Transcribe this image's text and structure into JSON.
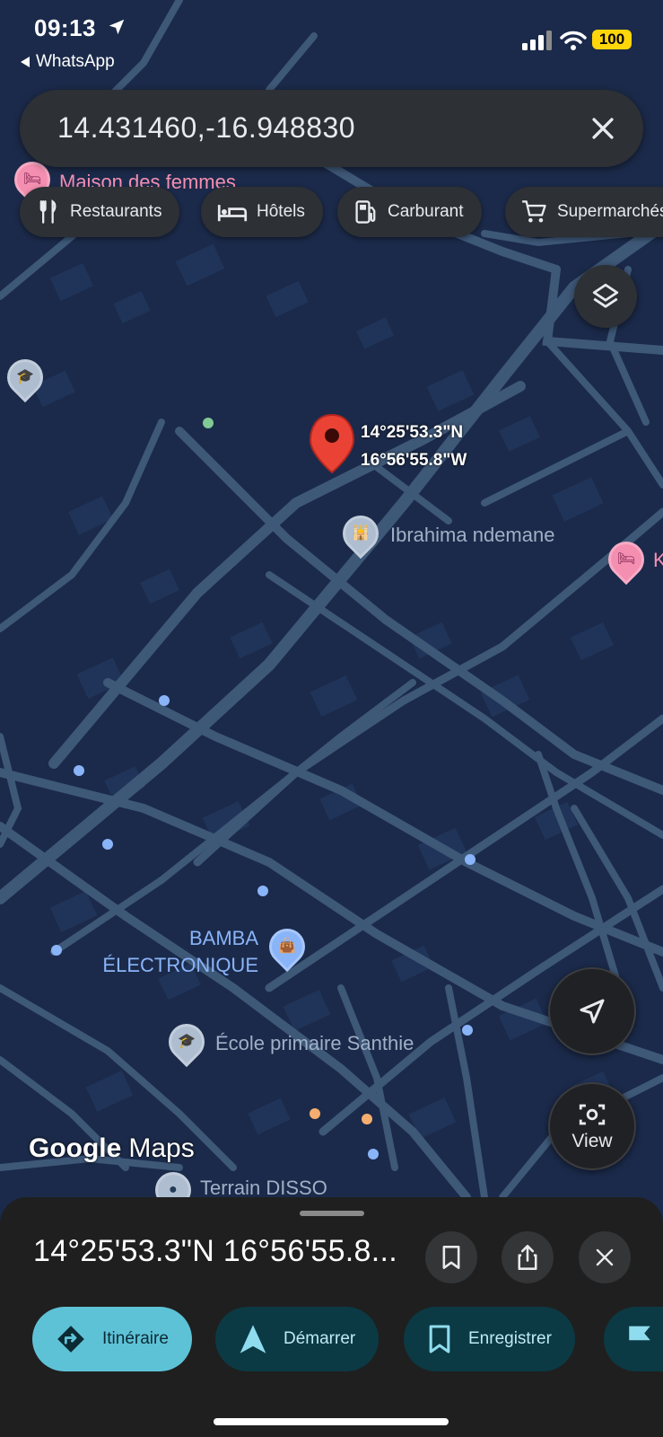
{
  "status_bar": {
    "time": "09:13",
    "back_app": "WhatsApp",
    "battery": "100"
  },
  "search": {
    "value": "14.431460,-16.948830"
  },
  "chips": [
    {
      "label": "Restaurants",
      "icon": "fork-knife-icon"
    },
    {
      "label": "Hôtels",
      "icon": "bed-icon"
    },
    {
      "label": "Carburant",
      "icon": "fuel-icon"
    },
    {
      "label": "Supermarchés",
      "icon": "cart-icon"
    }
  ],
  "map": {
    "pin_coords_line1": "14°25'53.3\"N",
    "pin_coords_line2": "16°56'55.8\"W",
    "pois": {
      "maison": "Maison des femmes",
      "mosque": "Ibrahima ndemane",
      "hotel_k": "K",
      "bamba_line1": "BAMBA",
      "bamba_line2": "ÉLECTRONIQUE",
      "ecole": "École primaire Santhie",
      "terrain": "Terrain DISSO"
    },
    "logo_google": "Google",
    "logo_maps": "Maps",
    "view_label": "View"
  },
  "sheet": {
    "title": "14°25'53.3\"N 16°56'55.8...",
    "actions": [
      {
        "label": "Itinéraire",
        "icon": "directions-icon"
      },
      {
        "label": "Démarrer",
        "icon": "navigation-arrow-icon"
      },
      {
        "label": "Enregistrer",
        "icon": "bookmark-icon"
      },
      {
        "label": "",
        "icon": "flag-icon"
      }
    ]
  },
  "colors": {
    "map_bg": "#1b2a4a",
    "road": "#3e5878",
    "pin": "#ea4335",
    "accent": "#5ec2d7",
    "poi_hotel": "#f48fb1"
  }
}
